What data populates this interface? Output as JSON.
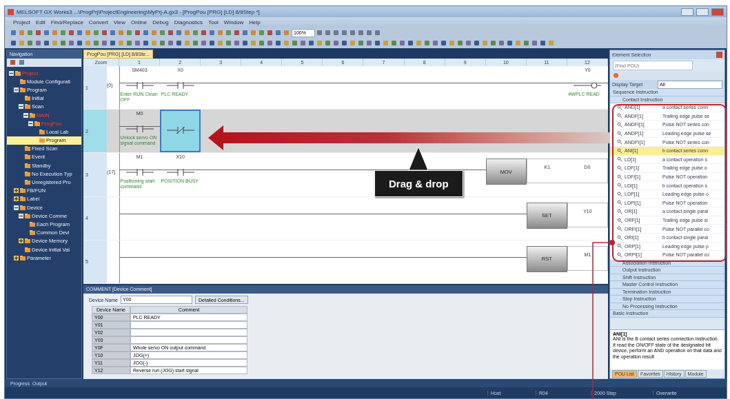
{
  "window": {
    "title": "MELSOFT GX Works3 ...\\ProgPrj\\ProjectEngineering\\MyPrj-A.gx3 - [ProgPou [PRG] [LD] 8/8Step *]",
    "menu": [
      "Project",
      "Edit",
      "Find/Replace",
      "Convert",
      "View",
      "Online",
      "Debug",
      "Diagnostics",
      "Tool",
      "Window",
      "Help"
    ]
  },
  "toolbar": {
    "zoom": "100%"
  },
  "navigation": {
    "title": "Navigation",
    "tree": [
      {
        "label": "Project",
        "alert": true,
        "expanded": true,
        "children": [
          {
            "label": "Module Configurati"
          },
          {
            "label": "Program",
            "expanded": true,
            "children": [
              {
                "label": "Initial"
              },
              {
                "label": "Scan",
                "expanded": true,
                "children": [
                  {
                    "label": "MAIN",
                    "alert": true,
                    "expanded": true,
                    "children": [
                      {
                        "label": "ProgPou",
                        "alert": true,
                        "expanded": true,
                        "children": [
                          {
                            "label": "Local Lab"
                          },
                          {
                            "label": "Program",
                            "selected": true
                          }
                        ]
                      }
                    ]
                  }
                ]
              },
              {
                "label": "Fixed Scan"
              },
              {
                "label": "Event"
              },
              {
                "label": "Standby"
              },
              {
                "label": "No Execution Typ"
              },
              {
                "label": "Unregistered Pro"
              }
            ]
          },
          {
            "label": "FB/FUN",
            "expanded": false
          },
          {
            "label": "Label",
            "expanded": false
          },
          {
            "label": "Device",
            "expanded": true,
            "children": [
              {
                "label": "Device Comme",
                "expanded": true,
                "children": [
                  {
                    "label": "Each Program"
                  },
                  {
                    "label": "Common Devi"
                  }
                ]
              },
              {
                "label": "Device Memory",
                "expanded": false
              },
              {
                "label": "Device Initial Val"
              }
            ]
          },
          {
            "label": "Parameter",
            "expanded": false
          }
        ]
      }
    ]
  },
  "editor": {
    "tab": "ProgPou [PRG] [LD] 8/8Ste...",
    "corner": "Zoom",
    "columns": [
      "1",
      "2",
      "3",
      "4",
      "5",
      "6",
      "7",
      "8",
      "9",
      "10",
      "11",
      "12"
    ],
    "rows": [
      {
        "number": "1",
        "step": "(0)",
        "selected": false,
        "elements": [
          {
            "kind": "a_contact",
            "device": "SM403",
            "comment": "Enter RUN Clean OFF",
            "selected": false
          },
          {
            "kind": "a_contact",
            "device": "X0",
            "comment": "PLC READY",
            "selected": false
          },
          {
            "kind": "coil",
            "device": "Y0",
            "comment": "#WPLC READ",
            "selected": false
          }
        ]
      },
      {
        "number": "2",
        "selected": true,
        "elements": [
          {
            "kind": "a_contact",
            "device": "M0",
            "comment": "Unlock servo ON signal command",
            "selected": false
          },
          {
            "kind": "b_contact",
            "selected": true
          }
        ]
      },
      {
        "number": "3",
        "step": "(17)",
        "selected": false,
        "elements": [
          {
            "kind": "a_contact",
            "device": "M1",
            "comment": "Positioning start command",
            "selected": false
          },
          {
            "kind": "a_contact",
            "device": "X10",
            "comment": "POSITION BUSY",
            "selected": false
          },
          {
            "kind": "instruction",
            "name": "MOV",
            "operands": [
              "K1",
              "D0"
            ],
            "selected": false
          }
        ]
      },
      {
        "number": "4",
        "selected": false,
        "elements": [
          {
            "kind": "instruction",
            "name": "SET",
            "operands": [
              "Y10"
            ],
            "selected": false
          }
        ]
      },
      {
        "number": "5",
        "selected": false,
        "elements": [
          {
            "kind": "instruction",
            "name": "RST",
            "operands": [
              "M1"
            ],
            "selected": false
          }
        ]
      }
    ]
  },
  "comment_panel": {
    "title": "COMMENT [Device Comment]",
    "device_name_label": "Device Name",
    "device_name": "Y00",
    "conditions_button": "Detailed Conditions...",
    "columns": [
      "Device Name",
      "Comment"
    ],
    "rows": [
      {
        "device": "Y00",
        "comment": "PLC READY"
      },
      {
        "device": "Y01"
      },
      {
        "device": "Y02"
      },
      {
        "device": "Y03"
      },
      {
        "device": "Y0F",
        "comment": "Whole servo ON output command"
      },
      {
        "device": "Y10",
        "comment": "JOG(+)"
      },
      {
        "device": "Y11",
        "comment": "JOG(-)"
      },
      {
        "device": "Y12",
        "comment": "Reverse run (JOG) start signal"
      }
    ]
  },
  "element_selection": {
    "title": "Element Selection",
    "find_placeholder": "(Find POU)",
    "display_target_label": "Display Target",
    "display_target": "All",
    "entries": [
      {
        "kind": "group",
        "label": "Sequence Instruction"
      },
      {
        "kind": "subgroup",
        "label": "Contact Instruction"
      },
      {
        "kind": "item",
        "name": "AND[1]",
        "description": "a contact series conn",
        "selected": false
      },
      {
        "kind": "item",
        "name": "ANDF[1]",
        "description": "Trailing edge pulse se",
        "selected": false
      },
      {
        "kind": "item",
        "name": "ANDFI[1]",
        "description": "Pulse NOT series con",
        "selected": false
      },
      {
        "kind": "item",
        "name": "ANDP[1]",
        "description": "Leading edge pulse se",
        "selected": false
      },
      {
        "kind": "item",
        "name": "ANDPI[1]",
        "description": "Pulse NOT series con",
        "selected": false
      },
      {
        "kind": "item",
        "name": "ANI[1]",
        "description": "b contact series conn",
        "selected": true
      },
      {
        "kind": "item",
        "name": "LD[1]",
        "description": "a contact operation s",
        "selected": false
      },
      {
        "kind": "item",
        "name": "LDF[1]",
        "description": "Trailing edge pulse o",
        "selected": false
      },
      {
        "kind": "item",
        "name": "LDFI[1]",
        "description": "Pulse NOT operation",
        "selected": false
      },
      {
        "kind": "item",
        "name": "LDI[1]",
        "description": "b contact operation s",
        "selected": false
      },
      {
        "kind": "item",
        "name": "LDP[1]",
        "description": "Leading edge pulse o",
        "selected": false
      },
      {
        "kind": "item",
        "name": "LDPI[1]",
        "description": "Pulse NOT operation",
        "selected": false
      },
      {
        "kind": "item",
        "name": "OR[1]",
        "description": "a contact single paral",
        "selected": false
      },
      {
        "kind": "item",
        "name": "ORF[1]",
        "description": "Trailing edge pulse si",
        "selected": false
      },
      {
        "kind": "item",
        "name": "ORFI[1]",
        "description": "Pulse NOT parallel co",
        "selected": false
      },
      {
        "kind": "item",
        "name": "ORI[1]",
        "description": "b contact single paral",
        "selected": false
      },
      {
        "kind": "item",
        "name": "ORP[1]",
        "description": "Leading edge pulse p",
        "selected": false
      },
      {
        "kind": "item",
        "name": "ORPI[1]",
        "description": "Pulse NOT parallel co",
        "selected": false
      },
      {
        "kind": "subgroup",
        "label": "Association Instruction"
      },
      {
        "kind": "subgroup",
        "label": "Output Instruction"
      },
      {
        "kind": "subgroup",
        "label": "Shift Instruction"
      },
      {
        "kind": "subgroup",
        "label": "Master Control Instruction"
      },
      {
        "kind": "subgroup",
        "label": "Termination Instruction"
      },
      {
        "kind": "subgroup",
        "label": "Stop Instruction"
      },
      {
        "kind": "subgroup",
        "label": "No Processing Instruction"
      },
      {
        "kind": "group",
        "label": "Basic Instruction"
      }
    ],
    "description_title": "ANI[1]",
    "description": "ANI is the B contact series connection instruction. It read the ON/OFF state of the designated bit device, perform an AND operation on that data and the operation result",
    "tabs": [
      {
        "label": "POU List",
        "selected": true
      },
      {
        "label": "Favorites",
        "selected": false
      },
      {
        "label": "History",
        "selected": false
      },
      {
        "label": "Module",
        "selected": false
      }
    ]
  },
  "bottom_tabs": [
    "Progress",
    "Output"
  ],
  "status_bar": [
    "Host",
    "R04",
    "2000 Step",
    "Overwrite"
  ],
  "annotation": {
    "label": "Drag & drop"
  }
}
